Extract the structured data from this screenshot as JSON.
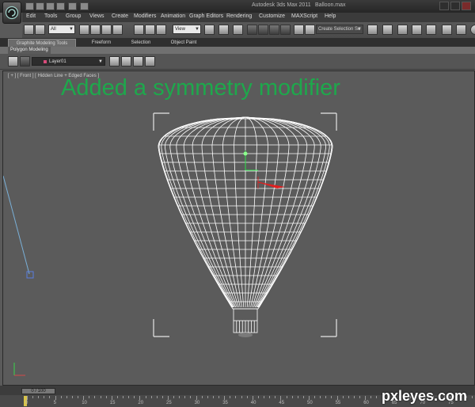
{
  "title": {
    "app": "Autodesk 3ds Max 2011",
    "file": "Balloon.max"
  },
  "menu": [
    "Edit",
    "Tools",
    "Group",
    "Views",
    "Create",
    "Modifiers",
    "Animation",
    "Graph Editors",
    "Rendering",
    "Customize",
    "MAXScript",
    "Help"
  ],
  "toolbar": {
    "selection_filter": "All",
    "reference_coord": "View",
    "named_selection_placeholder": "Create Selection Se"
  },
  "ribbon": {
    "tabs": [
      "Graphite Modeling Tools",
      "Freeform",
      "Selection",
      "Object Paint"
    ],
    "active_tab": "Graphite Modeling Tools",
    "panel": "Polygon Modeling"
  },
  "layer": {
    "current": "Layer01",
    "color": "#d84b7a"
  },
  "viewport": {
    "label": "[ + ] [ Front ] [ Hidden Line + Edged Faces ]",
    "annotation": "Added a symmetry modifier",
    "annotation_color": "#1ea84c"
  },
  "timeline": {
    "frame_display": "0 / 100",
    "ticks": [
      "0",
      "5",
      "10",
      "15",
      "20",
      "25",
      "30",
      "35",
      "40",
      "45",
      "50",
      "55",
      "60",
      "65",
      "70",
      "75"
    ]
  },
  "watermark": "pxleyes.com"
}
